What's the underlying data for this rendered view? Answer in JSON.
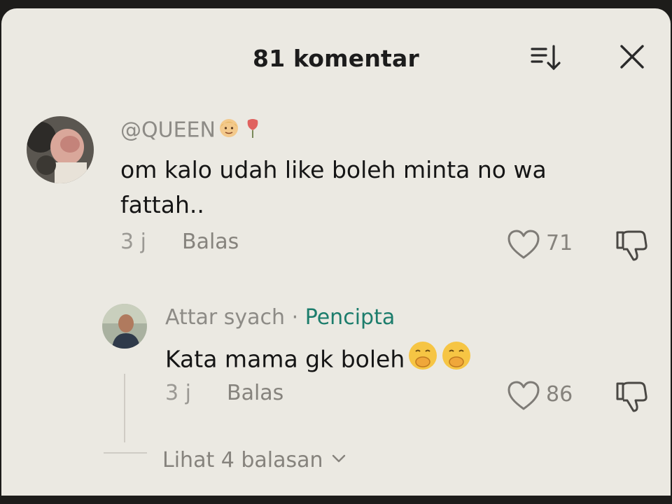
{
  "header": {
    "title": "81 komentar",
    "sort_icon": "sort-icon",
    "close_icon": "close-icon"
  },
  "comments": [
    {
      "username": "@QUEEN",
      "user_emojis": [
        "person-blond-emoji",
        "rose-emoji"
      ],
      "text": "om kalo udah like boleh minta no wa fattah..",
      "time": "3 j",
      "reply_label": "Balas",
      "likes": "71"
    }
  ],
  "replies": [
    {
      "username": "Attar syach",
      "separator": "·",
      "badge": "Pencipta",
      "text": "Kata mama gk boleh",
      "text_emojis": [
        "face-with-hand-over-mouth-emoji",
        "face-with-hand-over-mouth-emoji"
      ],
      "time": "3 j",
      "reply_label": "Balas",
      "likes": "86"
    }
  ],
  "more_replies_label": "Lihat 4 balasan",
  "colors": {
    "sheet_bg": "#ebe9e2",
    "creator_badge": "#1c7d6c",
    "muted_text": "#86837d"
  }
}
